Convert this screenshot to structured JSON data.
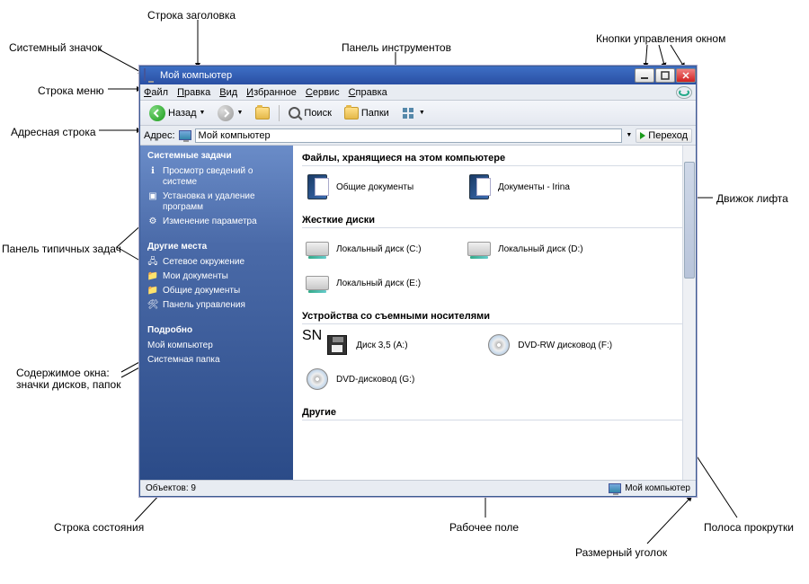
{
  "annotations": {
    "sys_icon": "Системный значок",
    "titlebar": "Строка заголовка",
    "toolbar": "Панель инструментов",
    "win_buttons": "Кнопки управления окном",
    "menubar": "Строка меню",
    "addressbar": "Адресная строка",
    "task_panel": "Панель типичных задач",
    "content": "Содержимое окна:\nзначки дисков, папок",
    "content_l1": "Содержимое окна:",
    "content_l2": "значки дисков, папок",
    "scroll_thumb": "Движок лифта",
    "statusbar": "Строка состояния",
    "workarea": "Рабочее поле",
    "resize": "Размерный уголок",
    "scrollbar": "Полоса прокрутки"
  },
  "title": "Мой компьютер",
  "menu": [
    "Файл",
    "Правка",
    "Вид",
    "Избранное",
    "Сервис",
    "Справка"
  ],
  "toolbar": {
    "back": "Назад",
    "search": "Поиск",
    "folders": "Папки"
  },
  "addr": {
    "label": "Адрес:",
    "value": "Мой компьютер",
    "go": "Переход"
  },
  "sidebar": {
    "sec1": {
      "title": "Системные задачи",
      "items": [
        "Просмотр сведений о системе",
        "Установка и удаление программ",
        "Изменение параметра"
      ]
    },
    "sec2": {
      "title": "Другие места",
      "items": [
        "Сетевое окружение",
        "Мои документы",
        "Общие документы",
        "Панель управления"
      ]
    },
    "sec3": {
      "title": "Подробно",
      "items": [
        "Мой компьютер",
        "Системная папка"
      ]
    }
  },
  "groups": {
    "g1": {
      "title": "Файлы, хранящиеся на этом компьютере",
      "items": [
        "Общие документы",
        "Документы - Irina"
      ]
    },
    "g2": {
      "title": "Жесткие диски",
      "items": [
        "Локальный диск (C:)",
        "Локальный диск (D:)",
        "Локальный диск (E:)"
      ]
    },
    "g3": {
      "title": "Устройства со съемными носителями",
      "items": [
        "Диск 3,5 (A:)",
        "DVD-RW дисковод (F:)",
        "DVD-дисковод (G:)"
      ]
    },
    "g4": {
      "title": "Другие"
    }
  },
  "status": {
    "left": "Объектов: 9",
    "right": "Мой компьютер"
  }
}
